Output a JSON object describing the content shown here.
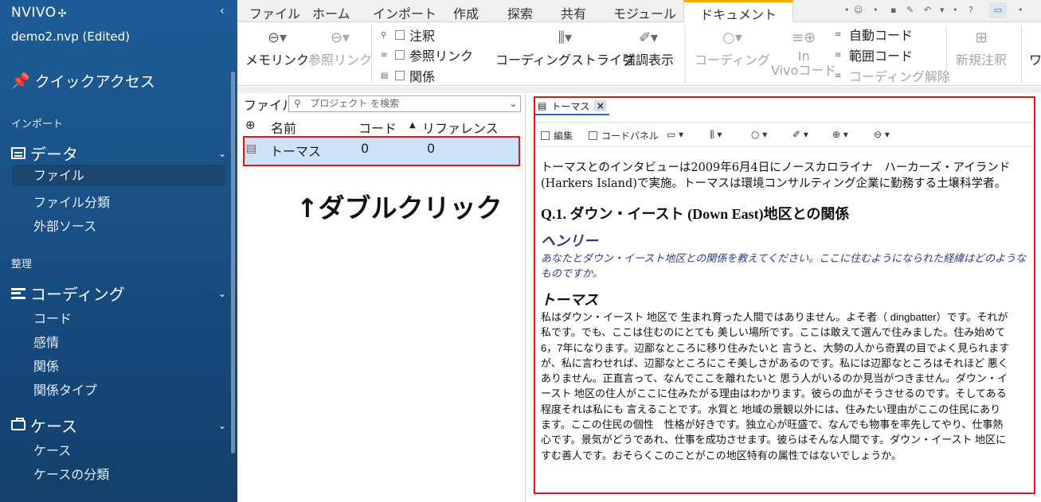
{
  "app": {
    "logo": "NVIVO",
    "logo_mark": "✣",
    "project": "demo2.nvp (Edited)"
  },
  "sidebar": {
    "quick_access": "クイックアクセス",
    "section_import": "インポート",
    "group_data": "データ",
    "items_data": [
      "ファイル",
      "ファイル分類",
      "外部ソース"
    ],
    "section_organize": "整理",
    "group_coding": "コーディング",
    "items_coding": [
      "コード",
      "感情",
      "関係",
      "関係タイプ"
    ],
    "group_cases": "ケース",
    "items_cases": [
      "ケース",
      "ケースの分類"
    ],
    "selected": "ファイル"
  },
  "ribbon_tabs": [
    "ファイル",
    "ホーム",
    "インポート",
    "作成",
    "探索",
    "共有",
    "モジュール",
    "ドキュメント"
  ],
  "active_tab": "ドキュメント",
  "ribbon": {
    "memo_link": "メモリンク",
    "see_also_link": "参照リンク",
    "annotations": "注釈",
    "see_also_links": "参照リンク",
    "relations": "関係",
    "coding_stripes": "コーディングストライプ",
    "highlight": "強調表示",
    "coding": "コーディング",
    "in_vivo": "In",
    "in_vivo_2": "Vivoコード",
    "auto_code": "自動コード",
    "range_code": "範囲コード",
    "uncode": "コーディング解除",
    "new_annotation": "新規注釈",
    "overflow": "ワ"
  },
  "list": {
    "label": "ファイル",
    "search_placeholder": "プロジェクト を検索",
    "col_name": "名前",
    "col_codes": "コード",
    "col_refs": "リファレンス",
    "rows": [
      {
        "name": "トーマス",
        "codes": "0",
        "refs": "0"
      }
    ],
    "instruction": "↑ダブルクリック"
  },
  "document": {
    "tab_title": "トーマス",
    "toolbar": {
      "edit": "編集",
      "code_panel": "コードパネル"
    },
    "intro": "トーマスとのインタビューは2009年6月4日にノースカロライナ　ハーカーズ・アイランド(Harkers Island)で実施。トーマスは環境コンサルティング企業に勤務する土壌科学者。",
    "heading": "Q.1. ダウン・イースト (Down East)地区との関係",
    "speaker1": "ヘンリー",
    "question": "あなたとダウン・イースト地区との関係を教えてください。ここに住むようになられた経緯はどのようなものですか。",
    "speaker2": "トーマス",
    "answer": "私はダウン・イースト 地区で 生まれ育った人間ではありません。よそ者（ dingbatter）です。それが私です。でも、ここは住むのにとても 美しい場所です。ここは敢えて選んで住みました。住み始めて6，7年になります。辺鄙なところに移り住みたいと 言うと、大勢の人から奇異の目でよく見られますが、私に言わせれば、辺鄙なところにこそ美しさがあるのです。私には辺鄙なところはそれほど 悪くありません。正直言って、なんでここを離れたいと 思う人がいるのか見当がつきません。ダウン・イースト 地区の住人がここに住みたがる理由はわかります。彼らの血がそうさせるのです。そしてある程度それは私にも 言えることです。水質と 地域の景観以外には、住みたい理由がここの住民にあります。ここの住民の個性　性格が好きです。独立心が旺盛で、なんでも物事を率先してやり、仕事熱心です。景気がどうであれ、仕事を成功させます。彼らはそんな人間です。ダウン・イースト 地区にすむ善人です。おそらくこのことがこの地区特有の属性ではないでしょうか。"
  }
}
